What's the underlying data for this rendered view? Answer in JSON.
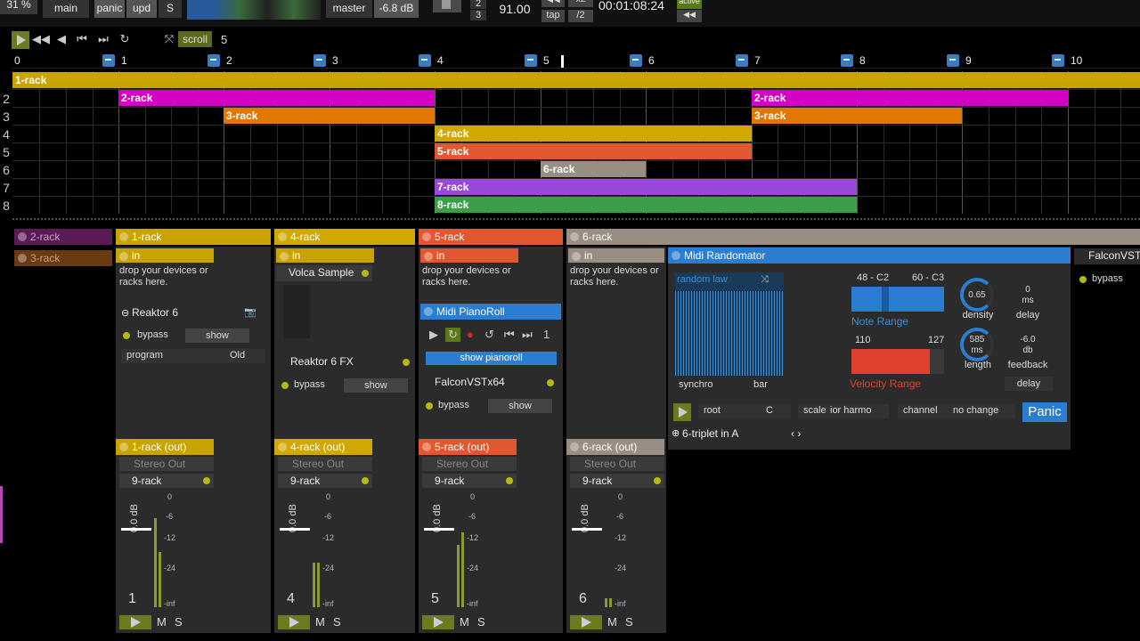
{
  "topbar": {
    "cpu": "31 %",
    "main": "main",
    "panic": "panic",
    "upd": "upd",
    "s": "S",
    "master": "master",
    "master_db": "-6.8 dB",
    "sig_top": "2",
    "sig_bottom": "3",
    "tempo": "91.00",
    "tap": "tap",
    "x2": "x2",
    "div2": "/2",
    "time": "00:01:08:24",
    "active": "active"
  },
  "transport": {
    "scroll": "scroll",
    "bars": "5"
  },
  "ruler": [
    "0",
    "1",
    "2",
    "3",
    "4",
    "5",
    "6",
    "7",
    "8",
    "9",
    "10"
  ],
  "rows": [
    "2",
    "3",
    "4",
    "5",
    "6",
    "7",
    "8"
  ],
  "clips": [
    {
      "label": "1-rack",
      "color": "#c9a300"
    },
    {
      "label": "2-rack",
      "color": "#d400c6"
    },
    {
      "label": "3-rack",
      "color": "#e07800"
    },
    {
      "label": "4-rack",
      "color": "#d1a800"
    },
    {
      "label": "5-rack",
      "color": "#e05830"
    },
    {
      "label": "6-rack",
      "color": "#9a8e82"
    },
    {
      "label": "7-rack",
      "color": "#9a48d8"
    },
    {
      "label": "8-rack",
      "color": "#3aa048"
    },
    {
      "label": "2-rack",
      "color": "#d400c6"
    },
    {
      "label": "3-rack",
      "color": "#e07800"
    }
  ],
  "left_racks": [
    "2-rack",
    "3-rack"
  ],
  "racks": [
    {
      "name": "1-rack",
      "out": "1-rack (out)",
      "color": "#c9a300",
      "num": "1"
    },
    {
      "name": "4-rack",
      "out": "4-rack (out)",
      "color": "#d1a800",
      "num": "4"
    },
    {
      "name": "5-rack",
      "out": "5-rack (out)",
      "color": "#e05830",
      "num": "5"
    },
    {
      "name": "6-rack",
      "out": "6-rack (out)",
      "color": "#9a8e82",
      "num": "6"
    }
  ],
  "common": {
    "in": "in",
    "drop": "drop your devices or racks here.",
    "bypass": "bypass",
    "show": "show",
    "stereo_out": "Stereo Out",
    "nine_rack": "9-rack",
    "db_label": "0.0 dB",
    "m": "M",
    "s": "S",
    "scale": [
      "0",
      "-6",
      "-12",
      "-24",
      "-inf"
    ]
  },
  "devices": {
    "reaktor6": "Reaktor 6",
    "program": "program",
    "program_val": "Old",
    "volca": "Volca Sample",
    "reaktor6fx": "Reaktor 6 FX",
    "pianoroll": "Midi PianoRoll",
    "pianoroll_num": "1",
    "show_pianoroll": "show pianoroll",
    "falcon": "FalconVSTx64",
    "falcon_short": "FalconVST"
  },
  "randomator": {
    "title": "Midi Randomator",
    "law": "random law",
    "synchro": "synchro",
    "bar": "bar",
    "note_lo": "48 - C2",
    "note_hi": "60 - C3",
    "note_range": "Note Range",
    "vel_lo": "110",
    "vel_hi": "127",
    "vel_range": "Velocity Range",
    "density_val": "0.65",
    "density": "density",
    "delay_val": "0",
    "delay_unit": "ms",
    "delay": "delay",
    "length_val": "585",
    "length_unit": "ms",
    "length": "length",
    "feedback_val": "-6.0",
    "feedback_unit": "db",
    "feedback": "feedback",
    "delay_btn": "delay",
    "root": "root",
    "root_val": "C",
    "scale": "scale",
    "scale_val": "ior harmo",
    "channel": "channel",
    "channel_val": "no change",
    "panic": "Panic",
    "triplet": "6-triplet in A"
  }
}
